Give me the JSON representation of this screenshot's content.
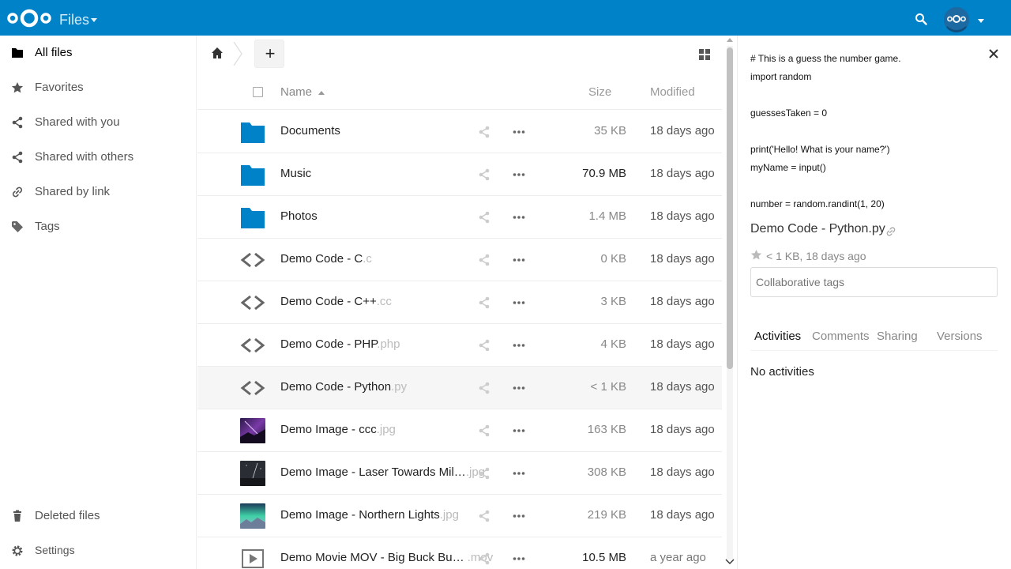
{
  "header": {
    "app_name": "Files",
    "search_icon": "search-icon",
    "avatar_icon": "avatar"
  },
  "sidebar": {
    "items": [
      {
        "label": "All files",
        "icon": "folder-icon"
      },
      {
        "label": "Favorites",
        "icon": "star-icon"
      },
      {
        "label": "Shared with you",
        "icon": "share-icon"
      },
      {
        "label": "Shared with others",
        "icon": "share-icon"
      },
      {
        "label": "Shared by link",
        "icon": "link-icon"
      },
      {
        "label": "Tags",
        "icon": "tag-icon"
      }
    ],
    "bottom": [
      {
        "label": "Deleted files",
        "icon": "trash-icon"
      },
      {
        "label": "Settings",
        "icon": "gear-icon"
      }
    ]
  },
  "toolbar": {
    "new_label": "+"
  },
  "table": {
    "col_name": "Name",
    "col_size": "Size",
    "col_modified": "Modified",
    "rows": [
      {
        "name": "Documents",
        "ext": "",
        "type": "folder",
        "size": "35 KB",
        "modified": "18 days ago"
      },
      {
        "name": "Music",
        "ext": "",
        "type": "folder",
        "size": "70.9 MB",
        "modified": "18 days ago"
      },
      {
        "name": "Photos",
        "ext": "",
        "type": "folder",
        "size": "1.4 MB",
        "modified": "18 days ago"
      },
      {
        "name": "Demo Code - C",
        "ext": ".c",
        "type": "code",
        "size": "0 KB",
        "modified": "18 days ago"
      },
      {
        "name": "Demo Code - C++",
        "ext": ".cc",
        "type": "code",
        "size": "3 KB",
        "modified": "18 days ago"
      },
      {
        "name": "Demo Code - PHP",
        "ext": ".php",
        "type": "code",
        "size": "4 KB",
        "modified": "18 days ago"
      },
      {
        "name": "Demo Code - Python",
        "ext": ".py",
        "type": "code",
        "size": "< 1 KB",
        "modified": "18 days ago"
      },
      {
        "name": "Demo Image - ccc",
        "ext": ".jpg",
        "type": "image",
        "size": "163 KB",
        "modified": "18 days ago"
      },
      {
        "name": "Demo Image - Laser Towards Mil…",
        "ext": ".jpg",
        "type": "image",
        "size": "308 KB",
        "modified": "18 days ago"
      },
      {
        "name": "Demo Image - Northern Lights",
        "ext": ".jpg",
        "type": "image",
        "size": "219 KB",
        "modified": "18 days ago"
      },
      {
        "name": "Demo Movie MOV - Big Buck Bu…",
        "ext": ".mov",
        "type": "video",
        "size": "10.5 MB",
        "modified": "a year ago"
      }
    ]
  },
  "details": {
    "preview_lines": "# This is a guess the number game.\nimport random\n\nguessesTaken = 0\n\nprint('Hello! What is your name?')\nmyName = input()\n\nnumber = random.randint(1, 20)",
    "file_name": "Demo Code - Python.py",
    "meta": "< 1 KB, 18 days ago",
    "tags_placeholder": "Collaborative tags",
    "tabs": [
      "Activities",
      "Comments",
      "Sharing",
      "Versions"
    ],
    "no_activities": "No activities"
  },
  "colors": {
    "brand": "#0082c9",
    "folder": "#0082c9"
  }
}
